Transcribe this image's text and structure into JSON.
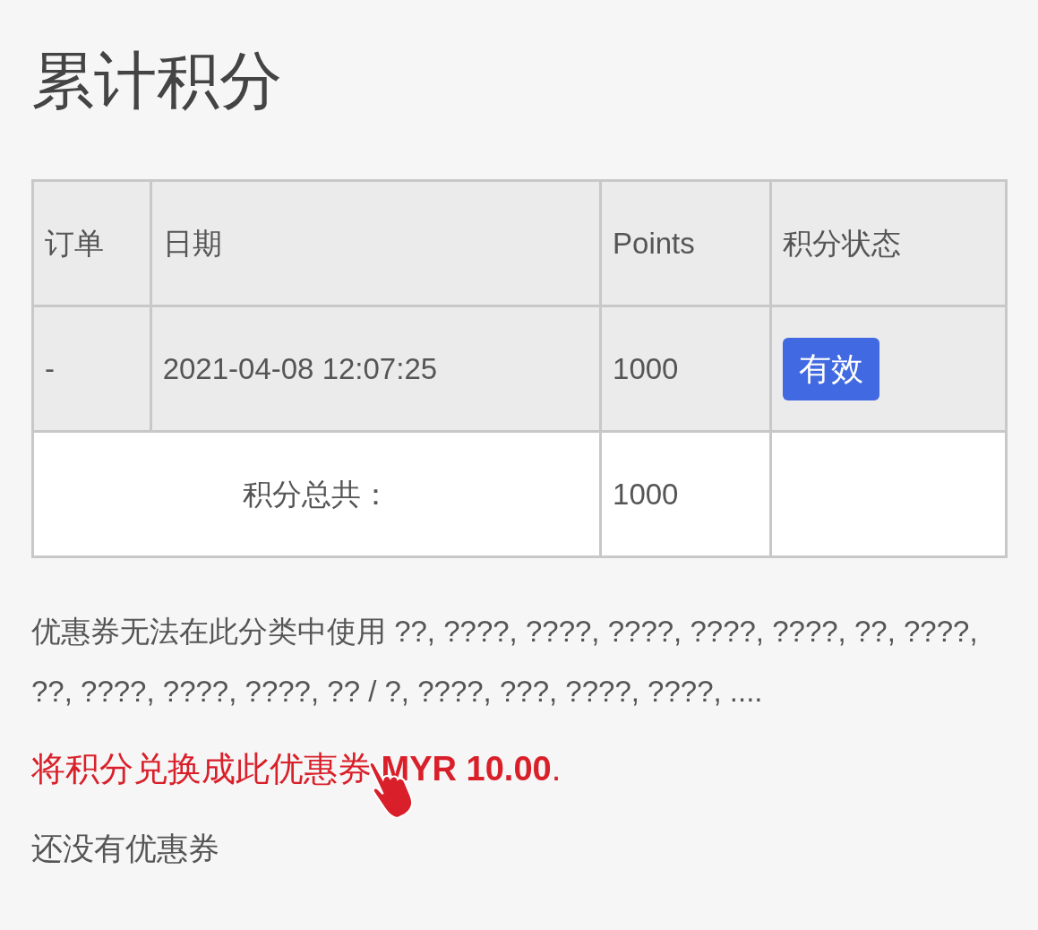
{
  "title": "累计积分",
  "table": {
    "columns": [
      "订单",
      "日期",
      "Points",
      "积分状态"
    ],
    "rows": [
      {
        "order": "-",
        "date": "2021-04-08 12:07:25",
        "points": "1000",
        "status": {
          "label": "有效",
          "kind": "valid"
        }
      }
    ],
    "total": {
      "label": "积分总共：",
      "points": "1000"
    }
  },
  "notice": "优惠券无法在此分类中使用 ??, ????, ????, ????, ????, ????, ??, ????, ??, ????, ????, ????, ?? / ?, ????, ???, ????, ????, ....",
  "redeem_link": "将积分兑换成此优惠券 **MYR 10.00**.",
  "empty_message": "还没有优惠券"
}
